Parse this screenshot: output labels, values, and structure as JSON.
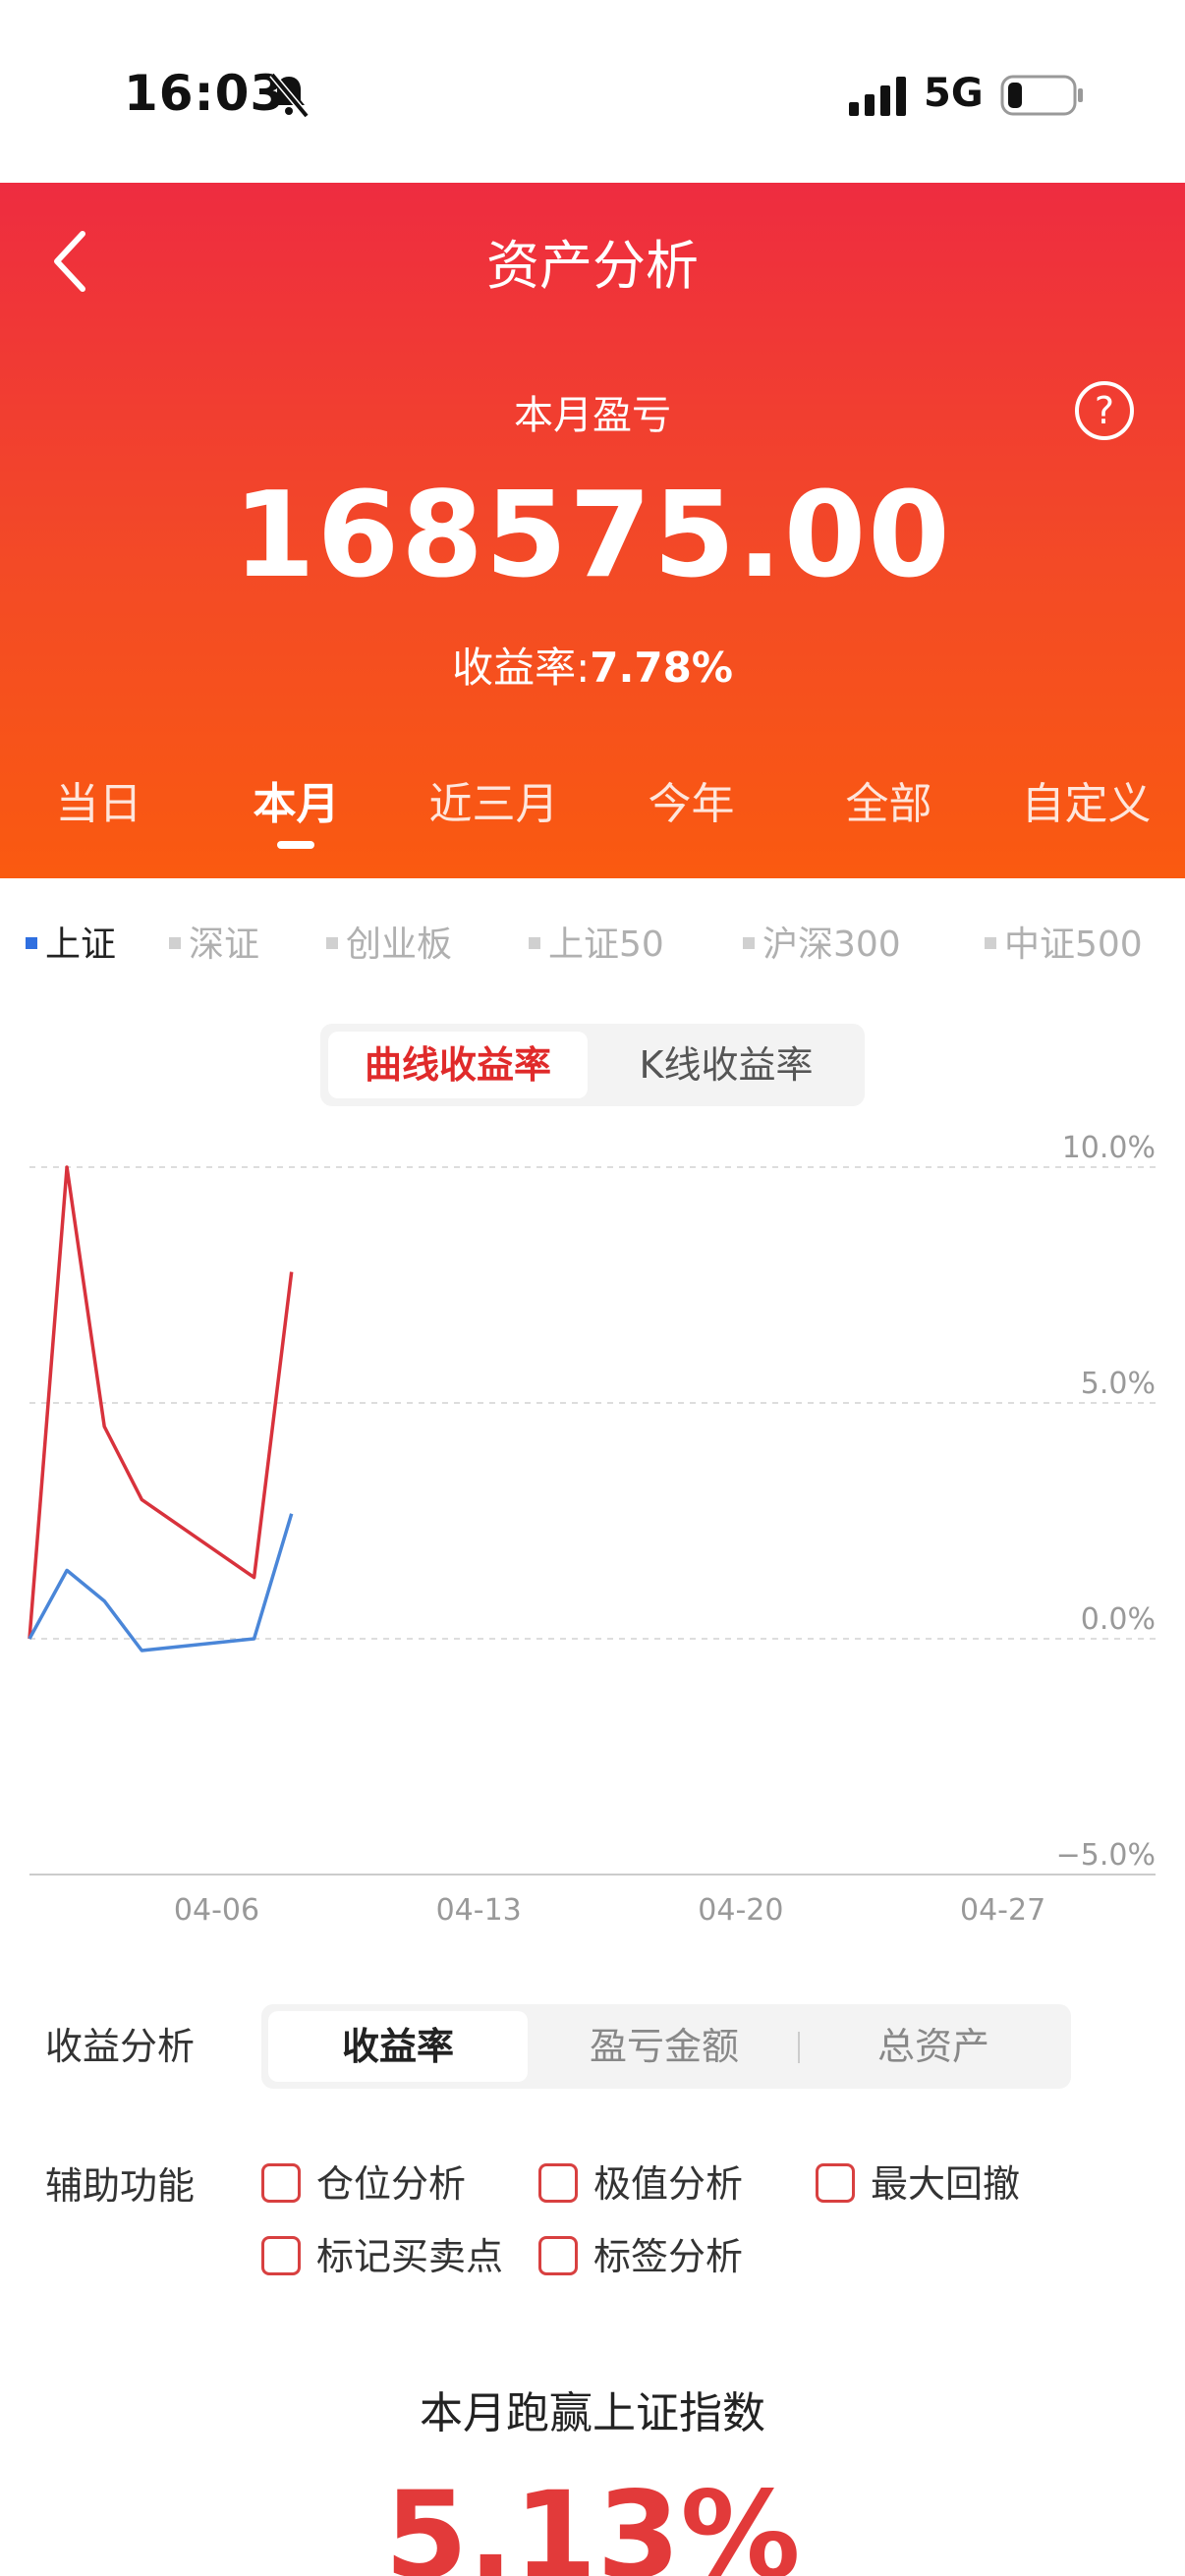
{
  "status_bar": {
    "time": "16:03",
    "network": "5G"
  },
  "header": {
    "title": "资产分析",
    "summary_label": "本月盈亏",
    "summary_value": "168575.00",
    "return_rate_label": "收益率:",
    "return_rate_value": "7.78%"
  },
  "period_tabs": [
    {
      "label": "当日",
      "active": false
    },
    {
      "label": "本月",
      "active": true
    },
    {
      "label": "近三月",
      "active": false
    },
    {
      "label": "今年",
      "active": false
    },
    {
      "label": "全部",
      "active": false
    },
    {
      "label": "自定义",
      "active": false
    }
  ],
  "index_tabs": [
    {
      "label": "上证",
      "active": true
    },
    {
      "label": "深证",
      "active": false
    },
    {
      "label": "创业板",
      "active": false
    },
    {
      "label": "上证50",
      "active": false
    },
    {
      "label": "沪深300",
      "active": false
    },
    {
      "label": "中证500",
      "active": false
    }
  ],
  "chart_mode": {
    "curve": "曲线收益率",
    "kline": "K线收益率"
  },
  "chart_data": {
    "type": "line",
    "title": "",
    "xlabel": "",
    "ylabel": "",
    "ylim": [
      -5.0,
      10.0
    ],
    "y_ticks": [
      "10.0%",
      "5.0%",
      "0.0%",
      "-5.0%"
    ],
    "x_ticks": [
      "04-06",
      "04-13",
      "04-20",
      "04-27"
    ],
    "x_range": [
      "04-01",
      "04-28"
    ],
    "grid": true,
    "legend": "none",
    "colors": {
      "portfolio": "#d8323c",
      "index": "#4a86d8"
    },
    "series": [
      {
        "key": "portfolio",
        "x": [
          "04-01",
          "04-02",
          "04-03",
          "04-04",
          "04-07",
          "04-08"
        ],
        "values": [
          0.0,
          10.0,
          4.5,
          2.95,
          1.3,
          7.78
        ]
      },
      {
        "key": "index",
        "x": [
          "04-01",
          "04-02",
          "04-03",
          "04-04",
          "04-07",
          "04-08"
        ],
        "values": [
          0.0,
          1.45,
          0.8,
          -0.25,
          0.0,
          2.65
        ]
      }
    ]
  },
  "analysis": {
    "label": "收益分析",
    "tabs": [
      "收益率",
      "盈亏金额",
      "总资产"
    ]
  },
  "auxiliary": {
    "label": "辅助功能",
    "options": [
      "仓位分析",
      "极值分析",
      "最大回撤",
      "标记买卖点",
      "标签分析"
    ]
  },
  "beat": {
    "title": "本月跑赢上证指数",
    "value": "5.13%"
  }
}
